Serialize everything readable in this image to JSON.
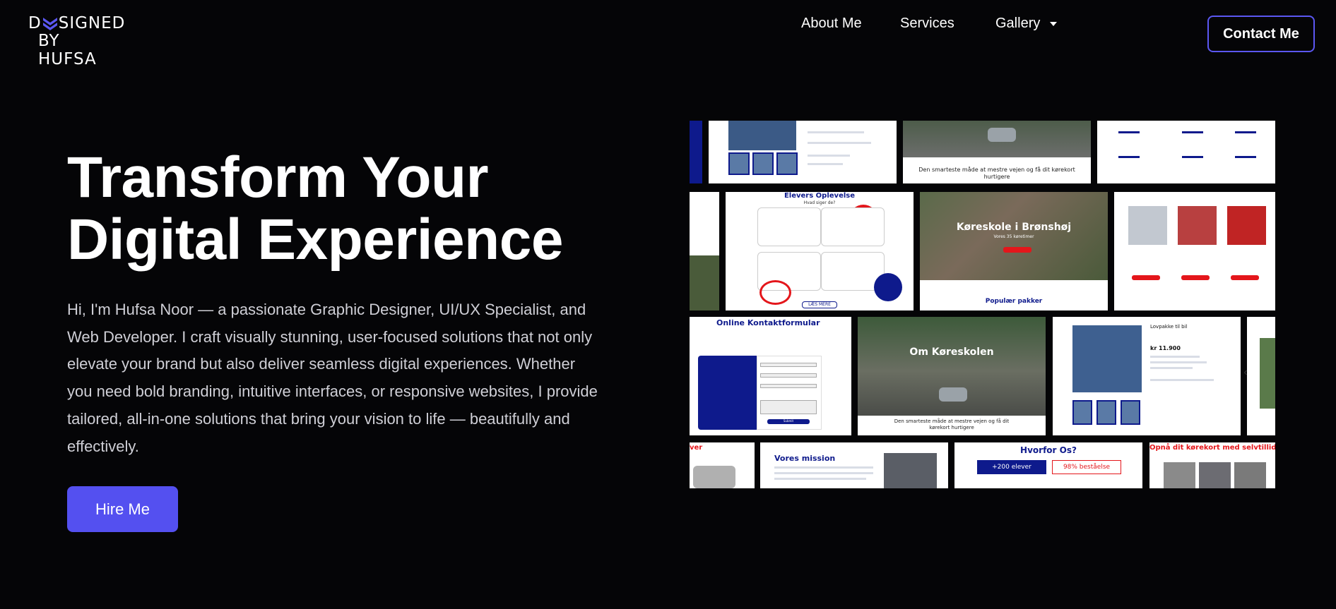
{
  "header": {
    "logo_line1_pre": "D",
    "logo_line1_post": "SIGNED",
    "logo_line2": "BY HUFSA",
    "nav": [
      {
        "label": "About Me"
      },
      {
        "label": "Services"
      },
      {
        "label": "Gallery"
      }
    ],
    "contact_label": "Contact Me"
  },
  "hero": {
    "title_line1": "Transform Your",
    "title_line2": "Digital Experience",
    "description": "Hi, I'm Hufsa Noor — a passionate Graphic Designer, UI/UX Specialist, and Web Developer. I craft visually stunning, user-focused solutions that not only elevate your brand but also deliver seamless digital experiences. Whether you need bold branding, intuitive interfaces, or responsive websites, I provide tailored, all-in-one solutions that bring your vision to life — beautifully and effectively.",
    "cta_label": "Hire Me"
  },
  "gallery": {
    "captions": {
      "road1": "Den smarteste måde at mestre vejen og få dit kørekort hurtigere",
      "elevers": "Elevers Oplevelse",
      "elevers_sub": "Hvad siger de?",
      "koreskole": "Køreskole i Brønshøj",
      "koreskole_sub": "Vores 35 køretimer",
      "populaer": "Populær pakker",
      "kontakt": "Online Kontaktformular",
      "om": "Om Køreskolen",
      "road2": "Den smarteste måde at mestre vejen og få dit kørekort hurtigere",
      "lovpakke": "Lovpakke til bil",
      "price": "kr 11.900",
      "mission": "Vores mission",
      "hvorfor": "Hvorfor Os?",
      "elever_count": "+200 elever",
      "bestaaelse": "98% beståelse",
      "opnaa": "Opnå dit kørekort med selvtillid o",
      "ver": "ver",
      "laes": "LÆS MERE",
      "submit": "Submit"
    }
  },
  "colors": {
    "accent": "#5450f0",
    "background": "#050507",
    "brand_blue": "#0e1a8c",
    "brand_red": "#e4161b"
  }
}
